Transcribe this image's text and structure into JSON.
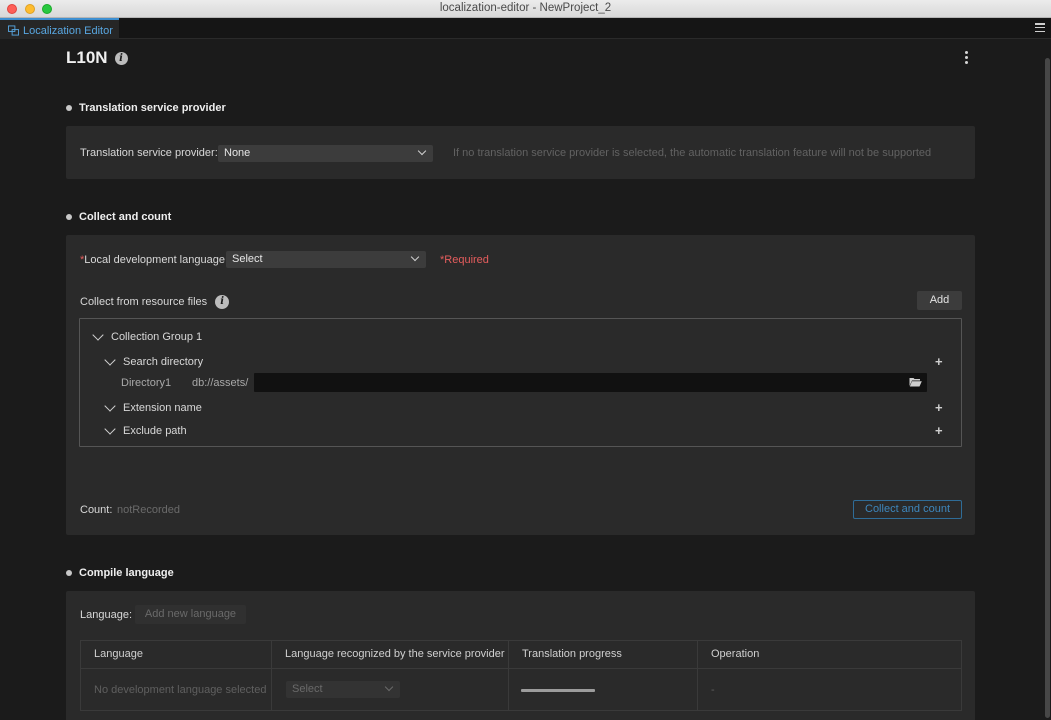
{
  "window": {
    "title": "localization-editor - NewProject_2"
  },
  "tab": {
    "label": "Localization Editor"
  },
  "page": {
    "title": "L10N"
  },
  "translation_service": {
    "heading": "Translation service provider",
    "field_label": "Translation service provider:",
    "selected": "None",
    "hint": "If no translation service provider is selected, the automatic translation feature will not be supported"
  },
  "collect": {
    "heading": "Collect and count",
    "local_lang_asterisk": "*",
    "local_lang_label": "Local development language:",
    "local_lang_selected": "Select",
    "required_text": "*Required",
    "resource_files_label": "Collect from resource files",
    "add_button": "Add",
    "group_label": "Collection Group 1",
    "search_directory_label": "Search directory",
    "directory_name": "Directory1",
    "directory_prefix": "db://assets/",
    "directory_value": "",
    "extension_label": "Extension name",
    "exclude_label": "Exclude path",
    "count_label": "Count:",
    "count_value": "notRecorded",
    "collect_button": "Collect and count"
  },
  "compile": {
    "heading": "Compile language",
    "language_label": "Language:",
    "add_language_button": "Add new language",
    "table": {
      "headers": [
        "Language",
        "Language recognized by the service provider",
        "Translation progress",
        "Operation"
      ],
      "row": {
        "language": "No development language selected",
        "service_select": "Select",
        "progress": 1.0,
        "operation": "-"
      }
    }
  }
}
